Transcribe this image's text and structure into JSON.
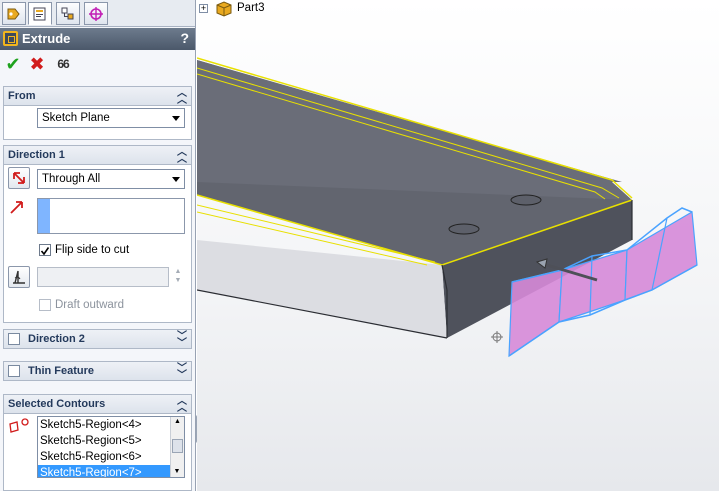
{
  "tree": {
    "part_name": "Part3",
    "expander": "+"
  },
  "titlebar": {
    "title": "Extrude",
    "help": "?"
  },
  "actions": {
    "ok_glyph": "✔",
    "cancel_glyph": "✖",
    "preview_glyph": "66"
  },
  "from": {
    "header": "From",
    "end_condition": "Sketch Plane"
  },
  "direction1": {
    "header": "Direction 1",
    "end_condition": "Through All",
    "flip_side_label": "Flip side to cut",
    "flip_side_checked": true,
    "draft_outward_label": "Draft outward",
    "draft_outward_checked": false
  },
  "direction2": {
    "header": "Direction 2"
  },
  "thin_feature": {
    "header": "Thin Feature"
  },
  "contours": {
    "header": "Selected Contours",
    "items": [
      "Sketch5-Region<4>",
      "Sketch5-Region<5>",
      "Sketch5-Region<6>",
      "Sketch5-Region<7>"
    ],
    "selected_index": 3
  },
  "colors": {
    "accent": "#3399ff",
    "model_top": "#6a6d78",
    "model_front": "#dcdde2",
    "highlight_edge": "#e8e000",
    "preview_fill": "#d68ad8",
    "preview_edge": "#4aa3ff"
  }
}
